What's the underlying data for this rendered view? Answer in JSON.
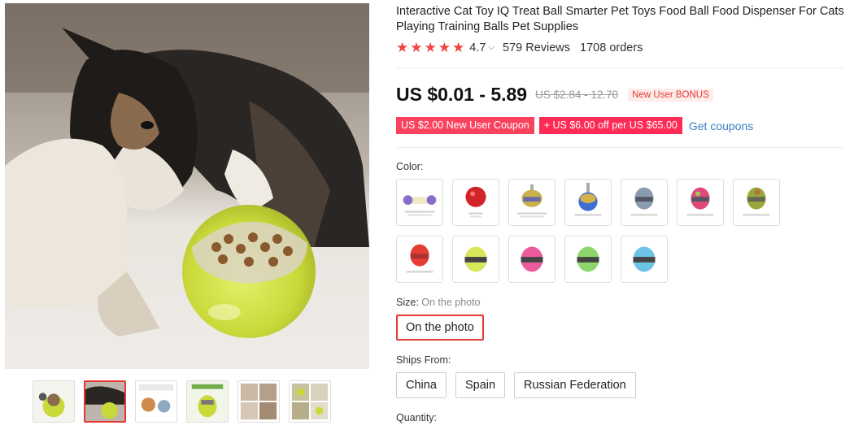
{
  "product": {
    "title": "Interactive Cat Toy IQ Treat Ball Smarter Pet Toys Food Ball Food Dispenser For Cats Playing Training Balls Pet Supplies",
    "rating": "4.7",
    "reviews": "579 Reviews",
    "orders": "1708 orders"
  },
  "price": {
    "current": "US $0.01 - 5.89",
    "original": "US $2.84 - 12.70",
    "badge": "New User BONUS"
  },
  "coupons": {
    "new_user": "US $2.00 New User Coupon",
    "store": "+ US $6.00 off per US $65.00",
    "get": "Get coupons"
  },
  "color": {
    "label": "Color:",
    "options": [
      "bone-purple",
      "red-ball",
      "yellow-tumbler-top",
      "blue-tumbler",
      "grey-egg",
      "pink-egg",
      "olive-egg",
      "red-egg",
      "yellow-egg",
      "pink-egg-2",
      "green-egg",
      "blue-egg"
    ]
  },
  "size": {
    "label": "Size:",
    "current": "On the photo",
    "options": [
      "On the photo"
    ]
  },
  "ships": {
    "label": "Ships From:",
    "options": [
      "China",
      "Spain",
      "Russian Federation"
    ]
  },
  "quantity": {
    "label": "Quantity:"
  },
  "gallery": {
    "thumb_count": 6,
    "active_index": 1
  },
  "colors": {
    "accent": "#e53935",
    "star": "#f1443f",
    "link": "#3d7ec8",
    "coupon": "#f9425e"
  }
}
